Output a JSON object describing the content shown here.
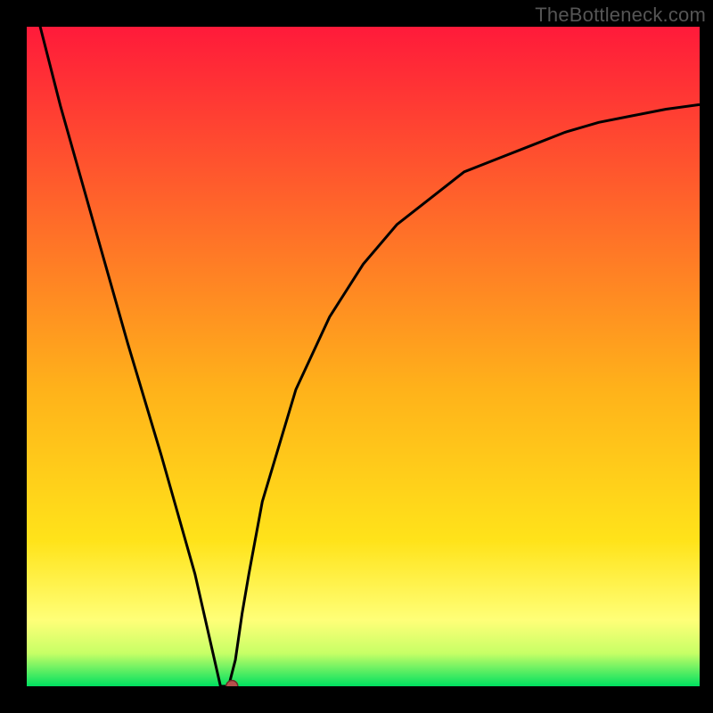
{
  "watermark": "TheBottleneck.com",
  "colors": {
    "frame": "#000000",
    "curve": "#000000",
    "dot_fill": "#b6504c",
    "dot_stroke": "#6d2b28",
    "gradient_stops": [
      {
        "offset": 0,
        "color": "#ff1a3a"
      },
      {
        "offset": 55,
        "color": "#ffb21a"
      },
      {
        "offset": 78,
        "color": "#ffe31a"
      },
      {
        "offset": 90,
        "color": "#ffff78"
      },
      {
        "offset": 95,
        "color": "#c7ff66"
      },
      {
        "offset": 100,
        "color": "#00e060"
      }
    ]
  },
  "chart_data": {
    "type": "line",
    "title": "",
    "xlabel": "",
    "ylabel": "",
    "x": [
      0.0,
      0.05,
      0.1,
      0.15,
      0.2,
      0.25,
      0.288,
      0.3,
      0.31,
      0.32,
      0.33,
      0.35,
      0.4,
      0.45,
      0.5,
      0.55,
      0.6,
      0.65,
      0.7,
      0.75,
      0.8,
      0.85,
      0.9,
      0.95,
      1.0
    ],
    "values": [
      1.08,
      0.88,
      0.7,
      0.52,
      0.35,
      0.17,
      0.0,
      0.0,
      0.04,
      0.11,
      0.17,
      0.28,
      0.45,
      0.56,
      0.64,
      0.7,
      0.74,
      0.78,
      0.8,
      0.82,
      0.84,
      0.855,
      0.865,
      0.875,
      0.882
    ],
    "ylim": [
      0,
      1
    ],
    "xlim": [
      0,
      1
    ],
    "marker": {
      "x": 0.305,
      "y": 0.0
    }
  }
}
